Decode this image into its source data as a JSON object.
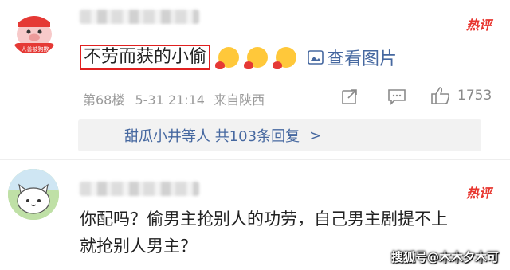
{
  "comments": [
    {
      "avatar_badge": "人善被狗欺",
      "hot_badge": "热评",
      "text": "不劳而获的小偷",
      "view_images": "查看图片",
      "floor": "第68楼",
      "date": "5-31 21:14",
      "location": "来自陕西",
      "likes": "1753",
      "replies_summary": "甜瓜小井等人 共103条回复"
    },
    {
      "hot_badge": "热评",
      "text": "你配吗？偷男主抢别人的功劳，自己男主剧提不上就抢别人男主？"
    }
  ],
  "watermark": "搜狐号@木木夕木可",
  "colors": {
    "hot": "#e8352e",
    "link": "#4668a0",
    "meta": "#9a9a9a",
    "highlight_box": "#e02020"
  }
}
